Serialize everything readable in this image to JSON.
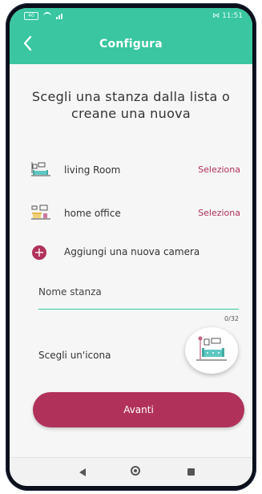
{
  "status_bar": {
    "battery": "40",
    "time": "11:51"
  },
  "app_bar": {
    "title": "Configura",
    "back_icon": "chevron-left-icon"
  },
  "heading": "Scegli una stanza dalla lista o creane una nuova",
  "rooms": [
    {
      "name": "living Room",
      "action": "Seleziona",
      "icon": "living-room-icon"
    },
    {
      "name": "home office",
      "action": "Seleziona",
      "icon": "home-office-icon"
    }
  ],
  "add_room": {
    "label": "Aggiungi una nuova camera",
    "icon": "plus-icon"
  },
  "name_field": {
    "label": "Nome stanza",
    "value": "",
    "counter": "0/32"
  },
  "icon_picker": {
    "label": "Scegli un'icona",
    "selected_icon": "living-room-icon"
  },
  "primary_button": {
    "label": "Avanti"
  },
  "colors": {
    "primary": "#39c6a0",
    "accent": "#b0325a",
    "background": "#f6f6f6"
  },
  "nav_bar": {
    "back_icon": "triangle-back-icon",
    "home_icon": "circle-home-icon",
    "recent_icon": "square-recent-icon"
  }
}
